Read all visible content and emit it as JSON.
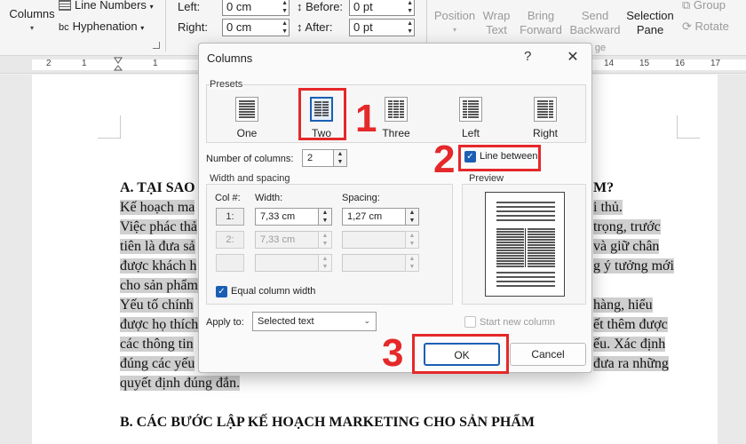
{
  "ribbon": {
    "columns": "Columns",
    "line_numbers": "Line Numbers",
    "hyphenation": "Hyphenation",
    "left_label": "Left:",
    "left_value": "0 cm",
    "right_label": "Right:",
    "right_value": "0 cm",
    "before_label": "Before:",
    "before_value": "0 pt",
    "after_label": "After:",
    "after_value": "0 pt",
    "position": "Position",
    "wrap_text": "Wrap Text",
    "bring_forward": "Bring Forward",
    "send_backward": "Send Backward",
    "selection_pane": "Selection Pane",
    "group": "Group",
    "rotate": "Rotate",
    "group_fragment": "ge"
  },
  "ruler": {
    "left_numbers": [
      "2",
      "1",
      "1"
    ],
    "right_numbers": [
      "14",
      "15",
      "16",
      "17"
    ]
  },
  "document": {
    "lines": [
      "A. TẠI SAO",
      "Kế hoạch ma",
      "Việc phác thả",
      "tiên là đưa sả",
      "được khách h",
      "cho sản phẩm",
      "Yếu tố chính",
      "được họ thích",
      "các thông tin",
      "đúng các yếu",
      "quyết định đúng đắn."
    ],
    "right_fragments": [
      "M?",
      "i thủ.",
      "trọng, trước",
      "và giữ chân",
      "g ý tưởng mới",
      "",
      "hàng, hiểu",
      "ết thêm được",
      "ếu. Xác định",
      "đưa ra những",
      ""
    ],
    "heading_b": "B. CÁC BƯỚC LẬP KẾ HOẠCH MARKETING CHO SẢN PHẨM"
  },
  "dialog": {
    "title": "Columns",
    "help": "?",
    "close": "✕",
    "presets_title": "Presets",
    "presets": [
      {
        "label": "One"
      },
      {
        "label": "Two"
      },
      {
        "label": "Three"
      },
      {
        "label": "Left"
      },
      {
        "label": "Right"
      }
    ],
    "num_columns_label": "Number of columns:",
    "num_columns_value": "2",
    "line_between": "Line between",
    "width_spacing_title": "Width and spacing",
    "col_header": "Col #:",
    "width_header": "Width:",
    "spacing_header": "Spacing:",
    "rows": [
      {
        "col": "1:",
        "width": "7,33 cm",
        "spacing": "1,27 cm"
      },
      {
        "col": "2:",
        "width": "7,33 cm",
        "spacing": ""
      },
      {
        "col": "",
        "width": "",
        "spacing": ""
      }
    ],
    "equal_width": "Equal column width",
    "apply_to_label": "Apply to:",
    "apply_to_value": "Selected text",
    "preview_title": "Preview",
    "start_new_column": "Start new column",
    "ok": "OK",
    "cancel": "Cancel"
  },
  "annotations": {
    "step1": "1",
    "step2": "2",
    "step3": "3",
    "color": "#e5282a"
  },
  "colors": {
    "accent": "#1a5fb4",
    "highlight": "#cfcfcf"
  }
}
